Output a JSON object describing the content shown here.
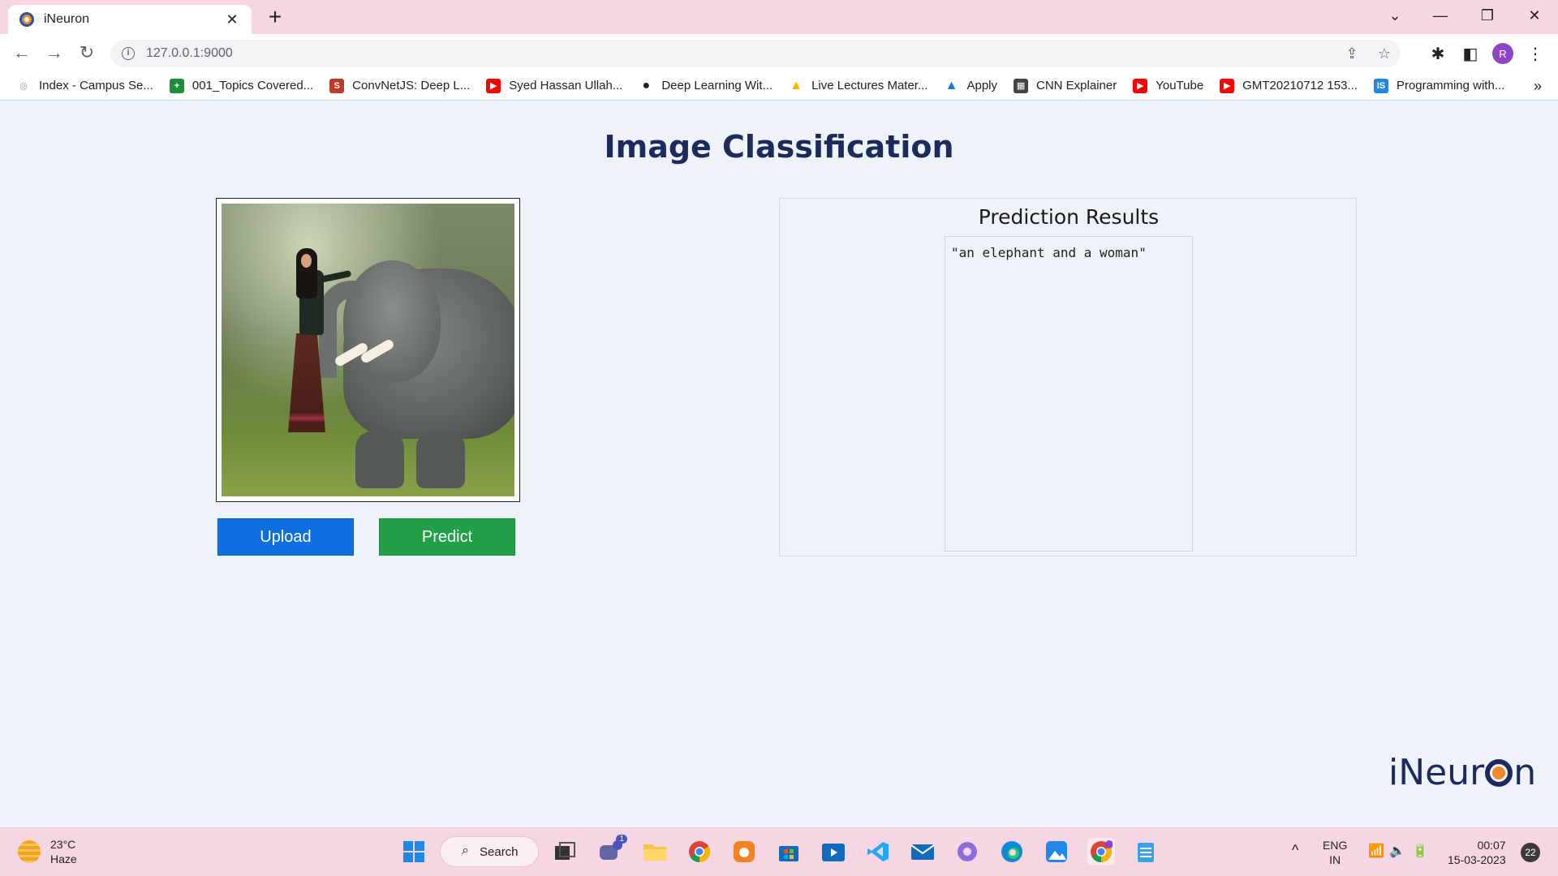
{
  "browser": {
    "tab_title": "iNeuron",
    "url": "127.0.0.1:9000",
    "profile_initial": "R",
    "bookmarks": [
      {
        "label": "Index - Campus Se...",
        "icon": "campus-icon",
        "color": "#cccccc"
      },
      {
        "label": "001_Topics Covered...",
        "icon": "sheets-icon",
        "color": "#1e8e3e"
      },
      {
        "label": "ConvNetJS: Deep L...",
        "icon": "s-icon",
        "color": "#c0392b"
      },
      {
        "label": "Syed Hassan Ullah...",
        "icon": "youtube-icon",
        "color": "#ff0000"
      },
      {
        "label": "Deep Learning Wit...",
        "icon": "globe-icon",
        "color": "#202124"
      },
      {
        "label": "Live Lectures Mater...",
        "icon": "drive-icon",
        "color": "#f4b400"
      },
      {
        "label": "Apply",
        "icon": "apply-icon",
        "color": "#1a73e8"
      },
      {
        "label": "CNN Explainer",
        "icon": "cnn-explainer-icon",
        "color": "#444444"
      },
      {
        "label": "YouTube",
        "icon": "youtube-icon",
        "color": "#ff0000"
      },
      {
        "label": "GMT20210712 153...",
        "icon": "youtube-icon",
        "color": "#ff0000"
      },
      {
        "label": "Programming with...",
        "icon": "is-icon",
        "color": "#1e88e5"
      }
    ]
  },
  "page": {
    "title": "Image Classification",
    "upload_label": "Upload",
    "predict_label": "Predict",
    "results_title": "Prediction Results",
    "result_text": "\"an elephant and a woman\"",
    "logo_text_left": "iNeur",
    "logo_text_right": "n"
  },
  "taskbar": {
    "temperature": "23°C",
    "weather": "Haze",
    "search_label": "Search",
    "teams_badge": "1",
    "lang_top": "ENG",
    "lang_bottom": "IN",
    "time": "00:07",
    "date": "15-03-2023",
    "notification_count": "22"
  },
  "colors": {
    "title": "#1c2a5c",
    "upload_button": "#0d6fe0",
    "predict_button": "#23a047",
    "tabstrip": "#f6d6e3"
  }
}
